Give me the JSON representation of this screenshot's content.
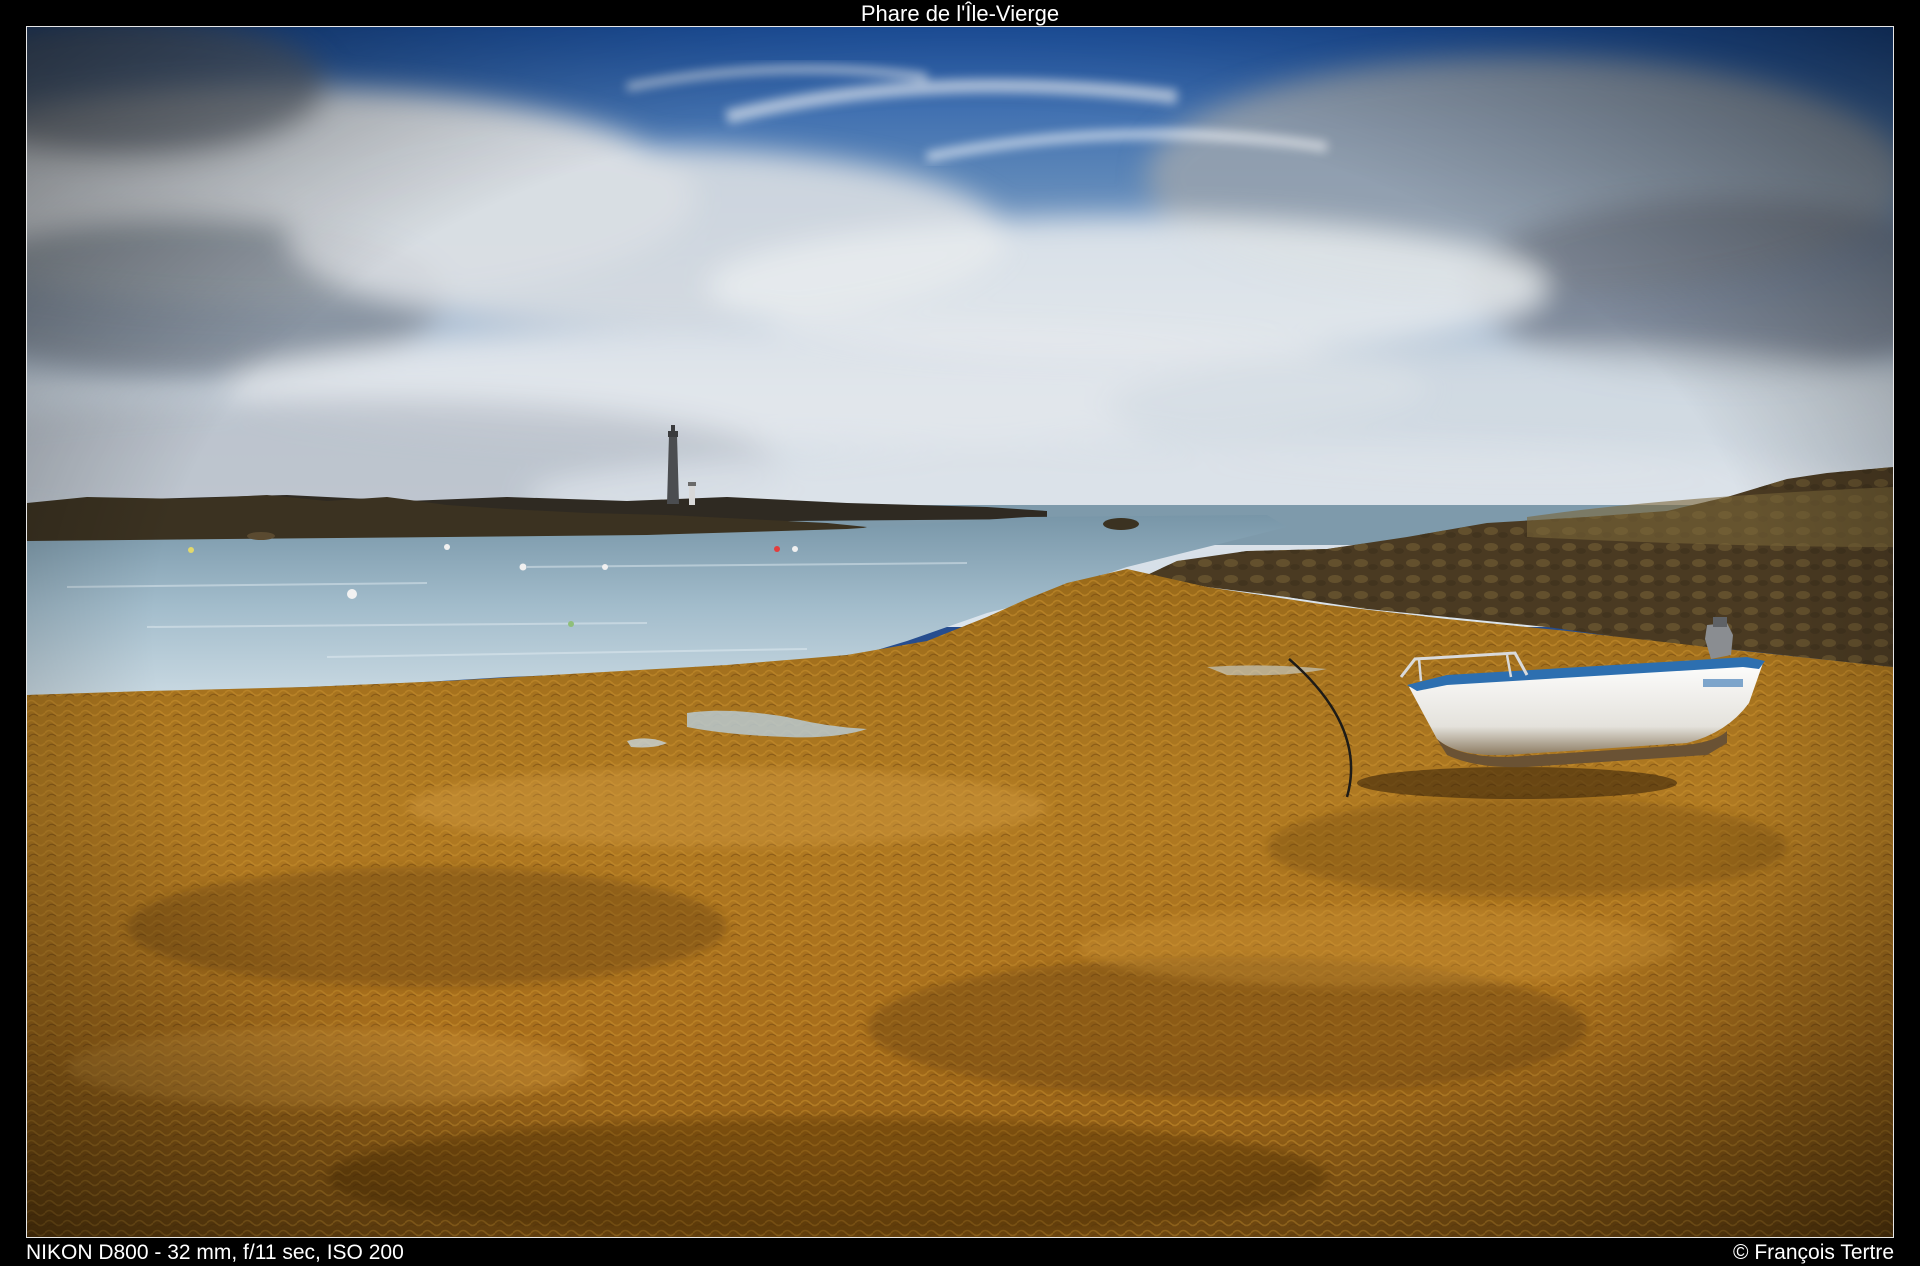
{
  "title": "Phare de l'Île-Vierge",
  "caption": {
    "exif": "NIKON D800 - 32 mm, f/11 sec, ISO 200",
    "copyright": "© François Tertre"
  },
  "colors": {
    "sky_blue": "#2a67b8",
    "cloud": "#dfe3e7",
    "sea": "#93afc0",
    "seaweed": "#b37b1c",
    "rocks": "#5a4626",
    "boat_hull": "#f2f2f0",
    "boat_stripe": "#2d6fb0"
  },
  "photo": {
    "subject": "lighthouse",
    "foreground": "boat"
  }
}
